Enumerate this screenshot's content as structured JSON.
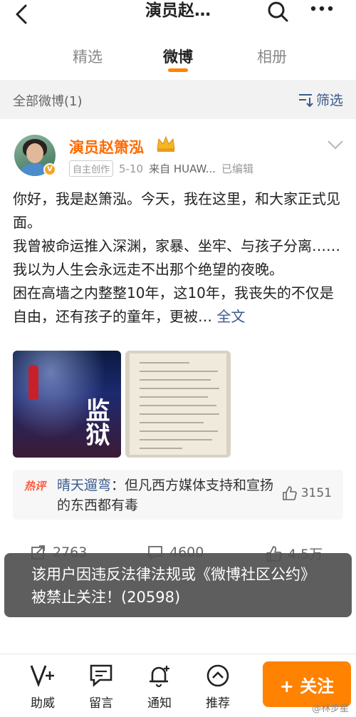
{
  "header": {
    "title": "演员赵…",
    "back_icon": "back-arrow-icon",
    "search_icon": "search-icon",
    "more_icon": "more-dots-icon"
  },
  "tabs": [
    {
      "label": "精选",
      "active": false
    },
    {
      "label": "微博",
      "active": true
    },
    {
      "label": "相册",
      "active": false
    }
  ],
  "accent_color": "#ff8200",
  "filter": {
    "count_label": "全部微博(1)",
    "filter_label": "筛选"
  },
  "post": {
    "username": "演员赵箫泓",
    "tag": "自主创作",
    "date": "5-10",
    "source": "来自 HUAW...",
    "edited": "已编辑",
    "content_line1": "你好，我是赵箫泓。今天，我在这里，和大家正式见面。",
    "content_line2": "我曾被命运推入深渊，家暴、坐牢、与孩子分离…… 我以为人生会永远走不出那个绝望的夜晚。",
    "content_line3": "困在高墙之内整整10年，这10年，我丧失的不仅是自由，还有孩子的童年，更被…",
    "more_link": "全文",
    "image1_text": "监狱",
    "hot_comment": {
      "badge": "热评",
      "user": "晴天遛弯",
      "text": "：但凡西方媒体支持和宣扬的东西都有毒",
      "likes": "3151"
    },
    "reposts": "2763",
    "comments": "4600",
    "likes": "4.5万"
  },
  "toast": {
    "text": "该用户因违反法律法规或《微博社区公约》被禁止关注！(20598)"
  },
  "bottom_bar": {
    "items": [
      {
        "label": "助威",
        "icon": "boost-icon"
      },
      {
        "label": "留言",
        "icon": "message-icon"
      },
      {
        "label": "通知",
        "icon": "bell-add-icon"
      },
      {
        "label": "推荐",
        "icon": "chevron-up-circle-icon"
      }
    ],
    "follow_label": "+ 关注"
  },
  "watermark": "@林步星"
}
